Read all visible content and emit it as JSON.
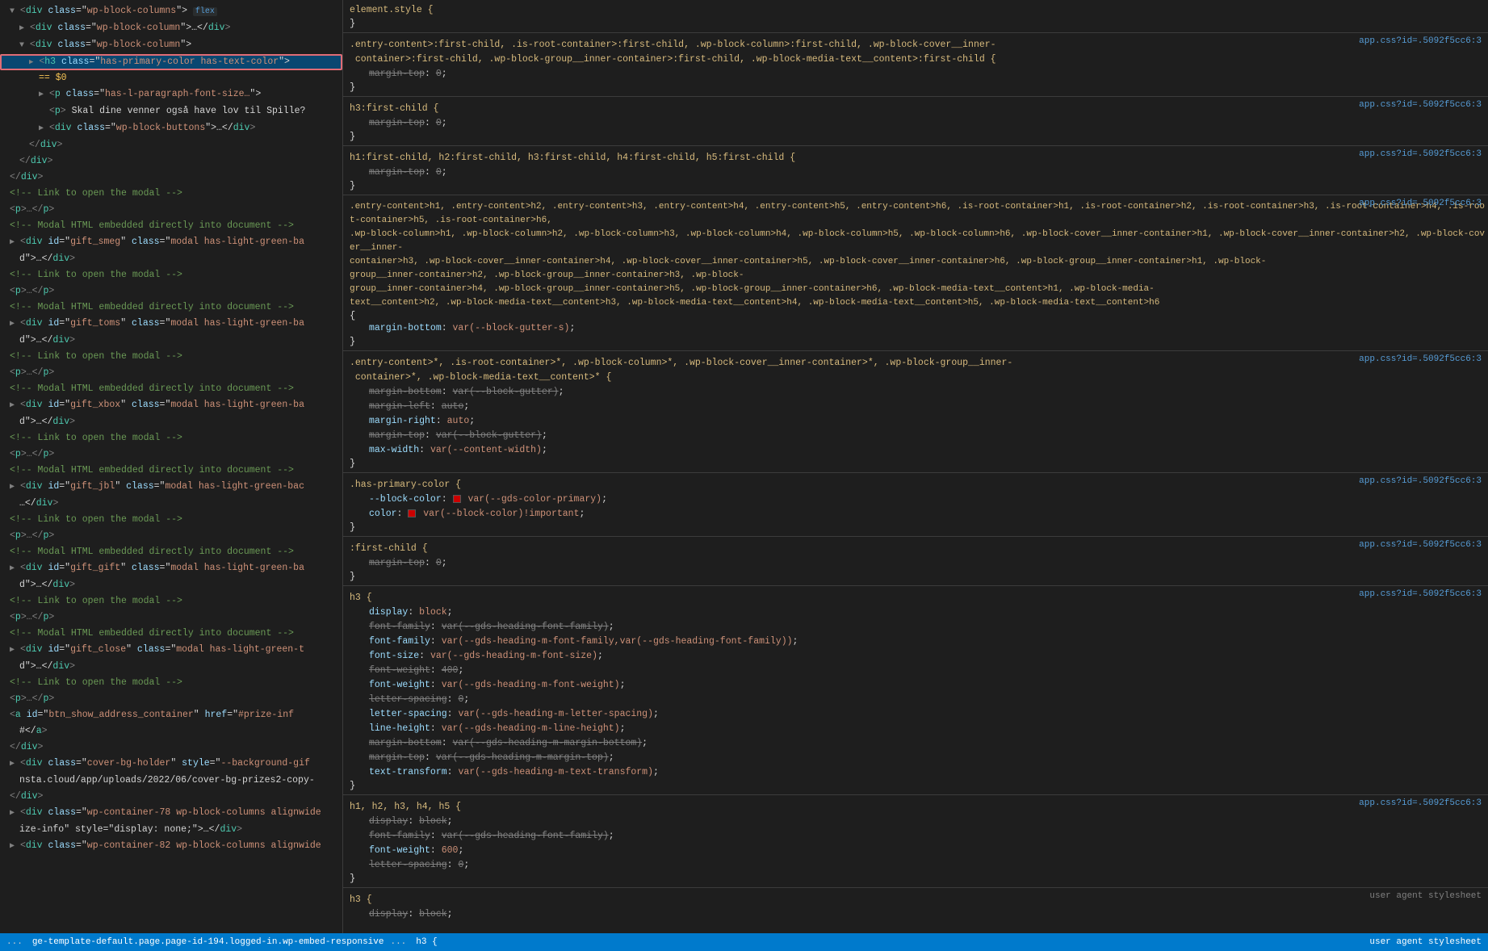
{
  "leftPanel": {
    "lines": [
      {
        "id": 1,
        "indent": 1,
        "type": "open-tag",
        "content": "▼<div class=\"wp-block-columns\"> flex",
        "class_highlight": "flex",
        "selected": false
      },
      {
        "id": 2,
        "indent": 2,
        "type": "open-tag",
        "content": "▶<div class=\"wp-block-column\">…</div>",
        "selected": false
      },
      {
        "id": 3,
        "indent": 2,
        "type": "open-tag",
        "content": "▼<div class=\"wp-block-column\">",
        "selected": false
      },
      {
        "id": 4,
        "indent": 3,
        "type": "highlighted",
        "content": "<h3 class=\"has-primary-color has-text-color\">",
        "selected": true
      },
      {
        "id": 5,
        "indent": 4,
        "type": "equals",
        "content": "== $0",
        "selected": false
      },
      {
        "id": 6,
        "indent": 4,
        "type": "tag",
        "content": "<p class=\"has-l-paragraph-font-size…\">",
        "selected": false
      },
      {
        "id": 7,
        "indent": 4,
        "type": "text",
        "content": "<p>Skal dine venner også have lov til Spille?",
        "selected": false
      },
      {
        "id": 8,
        "indent": 4,
        "type": "tag",
        "content": "▶<div class=\"wp-block-buttons\">…</div>",
        "selected": false
      },
      {
        "id": 9,
        "indent": 3,
        "type": "close-tag",
        "content": "</div>",
        "selected": false
      },
      {
        "id": 10,
        "indent": 2,
        "type": "close-tag",
        "content": "</div>",
        "selected": false
      },
      {
        "id": 11,
        "indent": 1,
        "type": "close-tag",
        "content": "</div>",
        "selected": false
      },
      {
        "id": 12,
        "indent": 1,
        "type": "comment",
        "content": "<!-- Link to open the modal -->",
        "selected": false
      },
      {
        "id": 13,
        "indent": 1,
        "type": "tag",
        "content": "<p>…</p>",
        "selected": false
      },
      {
        "id": 14,
        "indent": 1,
        "type": "comment",
        "content": "<!-- Modal HTML embedded directly into document -->",
        "selected": false
      },
      {
        "id": 15,
        "indent": 1,
        "type": "open-tag",
        "content": "▶<div id=\"gift_smeg\" class=\"modal has-light-green-ba",
        "selected": false
      },
      {
        "id": 16,
        "indent": 2,
        "type": "text",
        "content": "d\">…</div>",
        "selected": false
      },
      {
        "id": 17,
        "indent": 1,
        "type": "comment",
        "content": "<!-- Link to open the modal -->",
        "selected": false
      },
      {
        "id": 18,
        "indent": 1,
        "type": "tag",
        "content": "<p>…</p>",
        "selected": false
      },
      {
        "id": 19,
        "indent": 1,
        "type": "comment",
        "content": "<!-- Modal HTML embedded directly into document -->",
        "selected": false
      },
      {
        "id": 20,
        "indent": 1,
        "type": "open-tag",
        "content": "▶<div id=\"gift_toms\" class=\"modal has-light-green-ba",
        "selected": false
      },
      {
        "id": 21,
        "indent": 2,
        "type": "text",
        "content": "d\">…</div>",
        "selected": false
      },
      {
        "id": 22,
        "indent": 1,
        "type": "comment",
        "content": "<!-- Link to open the modal -->",
        "selected": false
      },
      {
        "id": 23,
        "indent": 1,
        "type": "tag",
        "content": "<p>…</p>",
        "selected": false
      },
      {
        "id": 24,
        "indent": 1,
        "type": "comment",
        "content": "<!-- Modal HTML embedded directly into document -->",
        "selected": false
      },
      {
        "id": 25,
        "indent": 1,
        "type": "open-tag",
        "content": "▶<div id=\"gift_xbox\" class=\"modal has-light-green-ba",
        "selected": false
      },
      {
        "id": 26,
        "indent": 2,
        "type": "text",
        "content": "d\">…</div>",
        "selected": false
      },
      {
        "id": 27,
        "indent": 1,
        "type": "comment",
        "content": "<!-- Link to open the modal -->",
        "selected": false
      },
      {
        "id": 28,
        "indent": 1,
        "type": "tag",
        "content": "<p>…</p>",
        "selected": false
      },
      {
        "id": 29,
        "indent": 1,
        "type": "comment",
        "content": "<!-- Modal HTML embedded directly into document -->",
        "selected": false
      },
      {
        "id": 30,
        "indent": 1,
        "type": "open-tag",
        "content": "▶<div id=\"gift_jbl\" class=\"modal has-light-green-bac",
        "selected": false
      },
      {
        "id": 31,
        "indent": 2,
        "type": "text",
        "content": "…</div>",
        "selected": false
      },
      {
        "id": 32,
        "indent": 1,
        "type": "comment",
        "content": "<!-- Link to open the modal -->",
        "selected": false
      },
      {
        "id": 33,
        "indent": 1,
        "type": "tag",
        "content": "<p>…</p>",
        "selected": false
      },
      {
        "id": 34,
        "indent": 1,
        "type": "comment",
        "content": "<!-- Modal HTML embedded directly into document -->",
        "selected": false
      },
      {
        "id": 35,
        "indent": 1,
        "type": "open-tag",
        "content": "▶<div id=\"gift_gift\" class=\"modal has-light-green-ba",
        "selected": false
      },
      {
        "id": 36,
        "indent": 2,
        "type": "text",
        "content": "d\">…</div>",
        "selected": false
      },
      {
        "id": 37,
        "indent": 1,
        "type": "comment",
        "content": "<!-- Link to open the modal -->",
        "selected": false
      },
      {
        "id": 38,
        "indent": 1,
        "type": "tag",
        "content": "<p>…</p>",
        "selected": false
      },
      {
        "id": 39,
        "indent": 1,
        "type": "comment",
        "content": "<!-- Modal HTML embedded directly into document -->",
        "selected": false
      },
      {
        "id": 40,
        "indent": 1,
        "type": "open-tag",
        "content": "▶<div id=\"gift_close\" class=\"modal has-light-green-t",
        "selected": false
      },
      {
        "id": 41,
        "indent": 2,
        "type": "text",
        "content": "d\">…</div>",
        "selected": false
      },
      {
        "id": 42,
        "indent": 1,
        "type": "comment",
        "content": "<!-- Link to open the modal -->",
        "selected": false
      },
      {
        "id": 43,
        "indent": 1,
        "type": "tag",
        "content": "<p>…</p>",
        "selected": false
      },
      {
        "id": 44,
        "indent": 1,
        "type": "tag",
        "content": "<a id=\"btn_show_address_container\" href=\"#prize-inf",
        "selected": false
      },
      {
        "id": 45,
        "indent": 2,
        "type": "text",
        "content": "#</a>",
        "selected": false
      },
      {
        "id": 46,
        "indent": 1,
        "type": "close-tag",
        "content": "</div>",
        "selected": false
      },
      {
        "id": 47,
        "indent": 1,
        "type": "open-tag",
        "content": "▶<div class=\"cover-bg-holder\" style=\"--background-gif",
        "selected": false
      },
      {
        "id": 48,
        "indent": 2,
        "type": "text",
        "content": "nsta.cloud/app/uploads/2022/06/cover-bg-prizes2-copy-",
        "selected": false
      },
      {
        "id": 49,
        "indent": 1,
        "type": "close-tag",
        "content": "</div>",
        "selected": false
      },
      {
        "id": 50,
        "indent": 1,
        "type": "open-tag",
        "content": "▶<div class=\"wp-container-78 wp-block-columns alignwide",
        "selected": false
      },
      {
        "id": 51,
        "indent": 2,
        "type": "text",
        "content": "ize-info\" style=\"display: none;\">…</div>",
        "selected": false
      },
      {
        "id": 52,
        "indent": 1,
        "type": "open-tag",
        "content": "▶<div class=\"wp-container-82 wp-block-columns alignwide",
        "selected": false
      }
    ]
  },
  "rightPanel": {
    "blocks": [
      {
        "id": "element-style",
        "selector": "element.style {",
        "source": "",
        "closing": "}",
        "properties": []
      },
      {
        "id": "block-entry",
        "selector": ".entry-content>:first-child, .is-root-container>:first-child, .wp-block-column>:first-child, .wp-block-cover__inner-\ncontainer>:first-child, .wp-block-group__inner-container>:first-child, .wp-block-media-text__content>:first-child {",
        "source": "app.css?id=5092f5cc6:3",
        "closing": "}",
        "properties": [
          {
            "name": "margin-top",
            "value": "0",
            "strikethrough": true,
            "important": false
          }
        ]
      },
      {
        "id": "h3-first-child",
        "selector": "h3:first-child {",
        "source": "app.css?id=5092f5cc6:3",
        "closing": "}",
        "properties": [
          {
            "name": "margin-top",
            "value": "0",
            "strikethrough": true,
            "important": false
          }
        ]
      },
      {
        "id": "h1-h5-first-child",
        "selector": "h1:first-child, h2:first-child, h3:first-child, h4:first-child, h5:first-child {",
        "source": "app.css?id=5092f5cc6:3",
        "closing": "}",
        "properties": [
          {
            "name": "margin-top",
            "value": "0",
            "strikethrough": true,
            "important": false
          }
        ]
      },
      {
        "id": "entry-content-all",
        "selector": ".entry-content>h1, .entry-content>h2, .entry-content>h3, .entry-content>h4, .entry-content>h5, .entry-content>h6, .is-root-\ncontainer>h1, .is-root-container>h2, .is-root-container>h3, .is-root-container>h4, .is-root-container>h5, .is-root-container>h6, .wp-block-column>h1, .wp-block-column>h2, .wp-block-\ncontainer>h3, .wp-block-column>h4, .wp-block-column>h5, .wp-block-column>h6, .wp-block-cover__inner-container>h1, .wp-block-cover__inner-container>h2, .wp-block-cover__inner-\ncontainer>h3, .wp-block-cover__inner-container>h4, .wp-block-cover__inner-container>h5, .wp-block-cover__inner-container>h6, .wp-block-group__inner-container>h1, .wp-block-\ngroup__inner-container>h2, .wp-block-group__inner-container>h3, .wp-block-\ngroup__inner-container>h4, .wp-block-group__inner-container>h5, .wp-block-group__inner-container>h6, .wp-block-media-text__content>h1, .wp-block-media-\ntext__content>h2, .wp-block-media-text__content>h3, .wp-block-media-text__content>h4, .wp-block-media-text__content>h5, .wp-block-media-text__content>h6",
        "source": "app.css?id=5092f5cc6:3",
        "closing": "}",
        "properties": [
          {
            "name": "margin-bottom",
            "value": "var(--block-gutter-s)",
            "strikethrough": false,
            "important": false
          }
        ]
      },
      {
        "id": "entry-content-star",
        "selector": ".entry-content>*, .is-root-container>*, .wp-block-column>*, .wp-block-cover__inner-container>*, .wp-block-group__inner-\ncontainer>*, .wp-block-media-text__content>* {",
        "source": "app.css?id=5092f5cc6:3",
        "closing": "}",
        "properties": [
          {
            "name": "margin-bottom",
            "value": "var(--block-gutter)",
            "strikethrough": true,
            "important": false
          },
          {
            "name": "margin-left",
            "value": "auto",
            "strikethrough": true,
            "important": false
          },
          {
            "name": "margin-right",
            "value": "auto",
            "strikethrough": false,
            "important": false
          },
          {
            "name": "margin-top",
            "value": "var(--block-gutter)",
            "strikethrough": true,
            "important": false
          },
          {
            "name": "max-width",
            "value": "var(--content-width)",
            "strikethrough": false,
            "important": false
          }
        ]
      },
      {
        "id": "has-primary-color",
        "selector": ".has-primary-color {",
        "source": "app.css?id=5092f5cc6:3",
        "closing": "}",
        "properties": [
          {
            "name": "--block-color",
            "value": "var(--gds-color-primary)",
            "strikethrough": false,
            "important": false,
            "swatch": "#cc0000"
          },
          {
            "name": "color",
            "value": "var(--block-color)!important",
            "strikethrough": false,
            "important": true,
            "swatch": "#cc0000"
          }
        ]
      },
      {
        "id": "first-child-pseudo",
        "selector": ":first-child {",
        "source": "app.css?id=5092f5cc6:3",
        "closing": "}",
        "properties": [
          {
            "name": "margin-top",
            "value": "0",
            "strikethrough": true,
            "important": false
          }
        ]
      },
      {
        "id": "h3-block",
        "selector": "h3 {",
        "source": "app.css?id=5092f5cc6:3",
        "closing": "}",
        "properties": [
          {
            "name": "display",
            "value": "block",
            "strikethrough": false,
            "important": false
          },
          {
            "name": "font-family",
            "value": "var(--gds-heading-font-family)",
            "strikethrough": true,
            "important": false
          },
          {
            "name": "font-family",
            "value": "var(--gds-heading-m-font-family,var(--gds-heading-font-family))",
            "strikethrough": false,
            "important": false
          },
          {
            "name": "font-size",
            "value": "var(--gds-heading-m-font-size)",
            "strikethrough": false,
            "important": false
          },
          {
            "name": "font-weight",
            "value": "400",
            "strikethrough": true,
            "important": false
          },
          {
            "name": "font-weight",
            "value": "var(--gds-heading-m-font-weight)",
            "strikethrough": false,
            "important": false
          },
          {
            "name": "letter-spacing",
            "value": "0",
            "strikethrough": true,
            "important": false
          },
          {
            "name": "letter-spacing",
            "value": "var(--gds-heading-m-letter-spacing)",
            "strikethrough": false,
            "important": false
          },
          {
            "name": "line-height",
            "value": "var(--gds-heading-m-line-height)",
            "strikethrough": false,
            "important": false
          },
          {
            "name": "margin-bottom",
            "value": "var(--gds-heading-m-margin-bottom)",
            "strikethrough": true,
            "important": false
          },
          {
            "name": "margin-top",
            "value": "var(--gds-heading-m-margin-top)",
            "strikethrough": true,
            "important": false
          },
          {
            "name": "text-transform",
            "value": "var(--gds-heading-m-text-transform)",
            "strikethrough": false,
            "important": false
          }
        ]
      },
      {
        "id": "h1-h5-block",
        "selector": "h1, h2, h3, h4, h5 {",
        "source": "app.css?id=5092f5cc6:3",
        "closing": "}",
        "properties": [
          {
            "name": "display",
            "value": "block",
            "strikethrough": true,
            "important": false
          },
          {
            "name": "font-family",
            "value": "var(--gds-heading-font-family)",
            "strikethrough": true,
            "important": false
          },
          {
            "name": "font-weight",
            "value": "600",
            "strikethrough": false,
            "important": false
          },
          {
            "name": "letter-spacing",
            "value": "0",
            "strikethrough": true,
            "important": false
          }
        ]
      },
      {
        "id": "h3-user-agent",
        "selector": "h3 {",
        "source": "user agent stylesheet",
        "closing": "}",
        "properties": [
          {
            "name": "display",
            "value": "block",
            "strikethrough": false,
            "important": false
          }
        ]
      }
    ]
  },
  "bottomBar": {
    "leftText": "ge-template-default.page.page-id-194.logged-in.wp-embed-responsive",
    "rightText": "user agent stylesheet",
    "dots": "...",
    "dots2": "..."
  }
}
